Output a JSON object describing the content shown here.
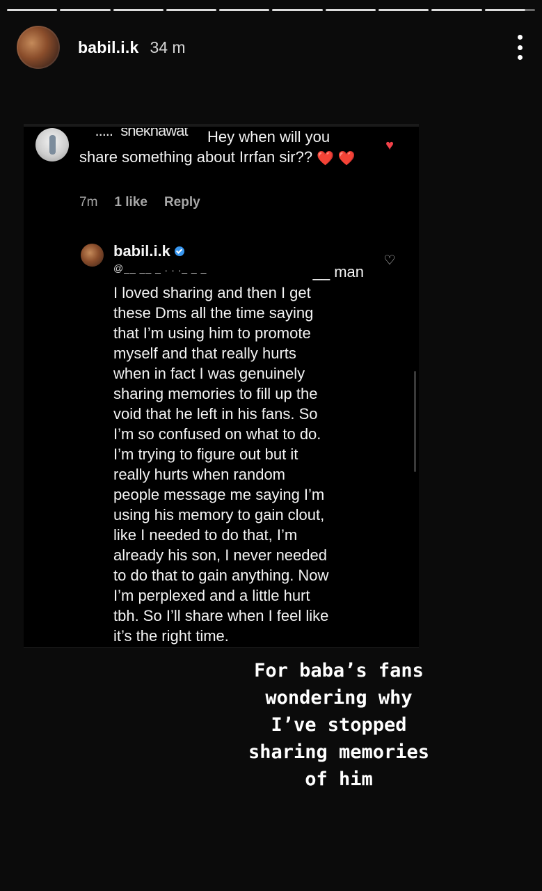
{
  "story": {
    "segments": 10,
    "username": "babil.i.k",
    "time": "34 m",
    "caption": "For baba’s fans\nwondering why\nI’ve stopped\nsharing memories\nof him"
  },
  "comment": {
    "username_fragment": "__....._sneknawat__",
    "text_after_name": " Hey when will you share something about Irrfan sir??",
    "emoji": "❤️ ❤️",
    "meta": {
      "time": "7m",
      "likes": "1 like",
      "reply": "Reply"
    },
    "liked_icon": "heart-filled-icon"
  },
  "reply": {
    "username": "babil.i.k",
    "verified_icon": "verified-badge-icon",
    "mention_fragment": "@__ __ _ . . ._ _ _",
    "mention_end": "__ man",
    "text": "I loved sharing and then I get\nthese Dms all the time saying\nthat I’m using him to promote\nmyself and that really hurts\nwhen in fact I was genuinely\nsharing memories to fill up the\nvoid that he left in his fans. So\nI’m so confused on what to do.\nI’m trying to figure out but it\nreally hurts when random\npeople message me saying I’m\nusing his memory to gain clout,\nlike I needed to do that, I’m\nalready his son, I never needed\nto do that to gain anything. Now\nI’m perplexed and a little hurt\ntbh. So I’ll share when I feel like\nit’s the right time.",
    "like_icon": "heart-outline-icon"
  },
  "colors": {
    "background": "#0b0b0b",
    "liked_heart": "#f24149",
    "verified": "#3897f0"
  }
}
